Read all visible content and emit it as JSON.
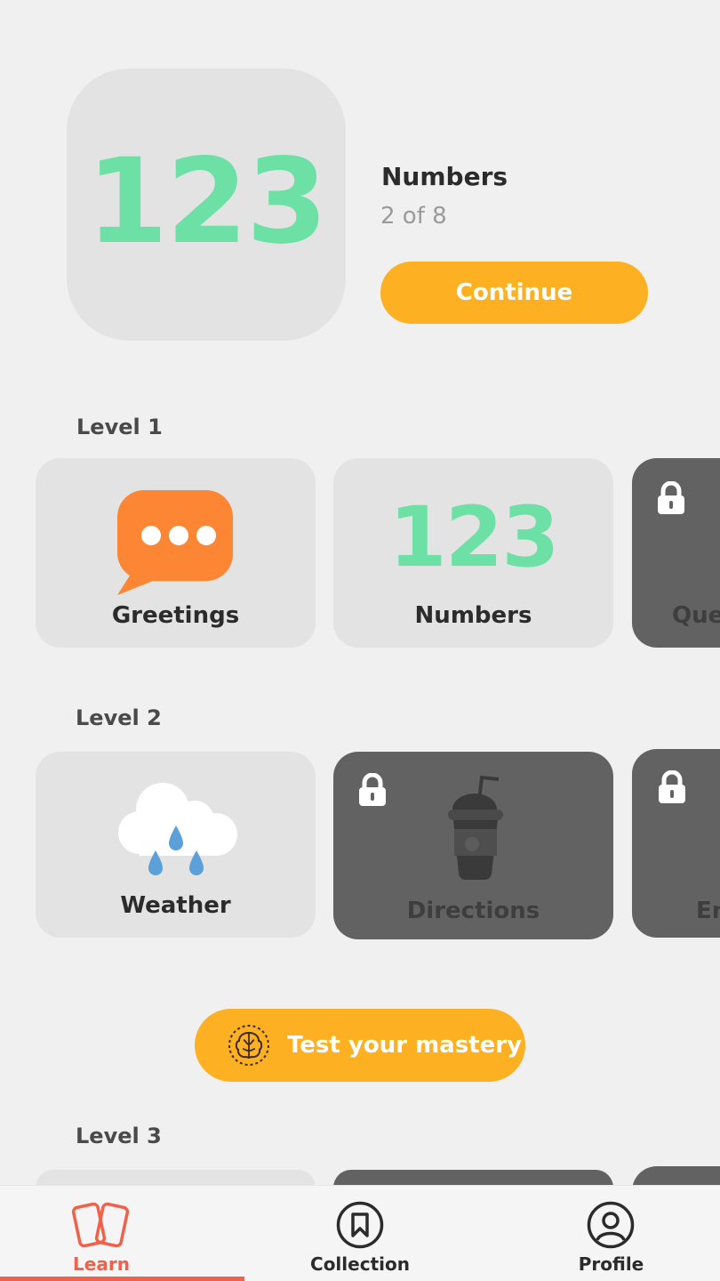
{
  "hero": {
    "icon_text": "123",
    "title": "Numbers",
    "progress": "2 of 8",
    "continue_label": "Continue"
  },
  "levels": [
    {
      "label": "Level 1",
      "cards": [
        {
          "label": "Greetings",
          "icon": "speech-bubble-icon",
          "locked": false
        },
        {
          "label": "Numbers",
          "icon_text": "123",
          "locked": false
        },
        {
          "label": "Que",
          "icon": "lock-icon",
          "locked": true
        }
      ]
    },
    {
      "label": "Level 2",
      "cards": [
        {
          "label": "Weather",
          "icon": "rain-cloud-icon",
          "locked": false
        },
        {
          "label": "Directions",
          "icon": "drink-cup-icon",
          "locked": true
        },
        {
          "label": "En",
          "icon": "lock-icon",
          "locked": true
        }
      ]
    },
    {
      "label": "Level 3",
      "cards": []
    }
  ],
  "mastery": {
    "label": "Test your mastery",
    "icon": "brain-icon"
  },
  "nav": {
    "items": [
      {
        "label": "Learn",
        "icon": "cards-icon",
        "active": true
      },
      {
        "label": "Collection",
        "icon": "bookmark-icon",
        "active": false
      },
      {
        "label": "Profile",
        "icon": "profile-icon",
        "active": false
      }
    ]
  },
  "colors": {
    "accent_orange": "#fcb022",
    "numbers_green": "#6de0a5",
    "active_red": "#f1614a",
    "locked_gray": "#626262",
    "card_gray": "#e3e3e3",
    "background": "#f0f0f0"
  }
}
